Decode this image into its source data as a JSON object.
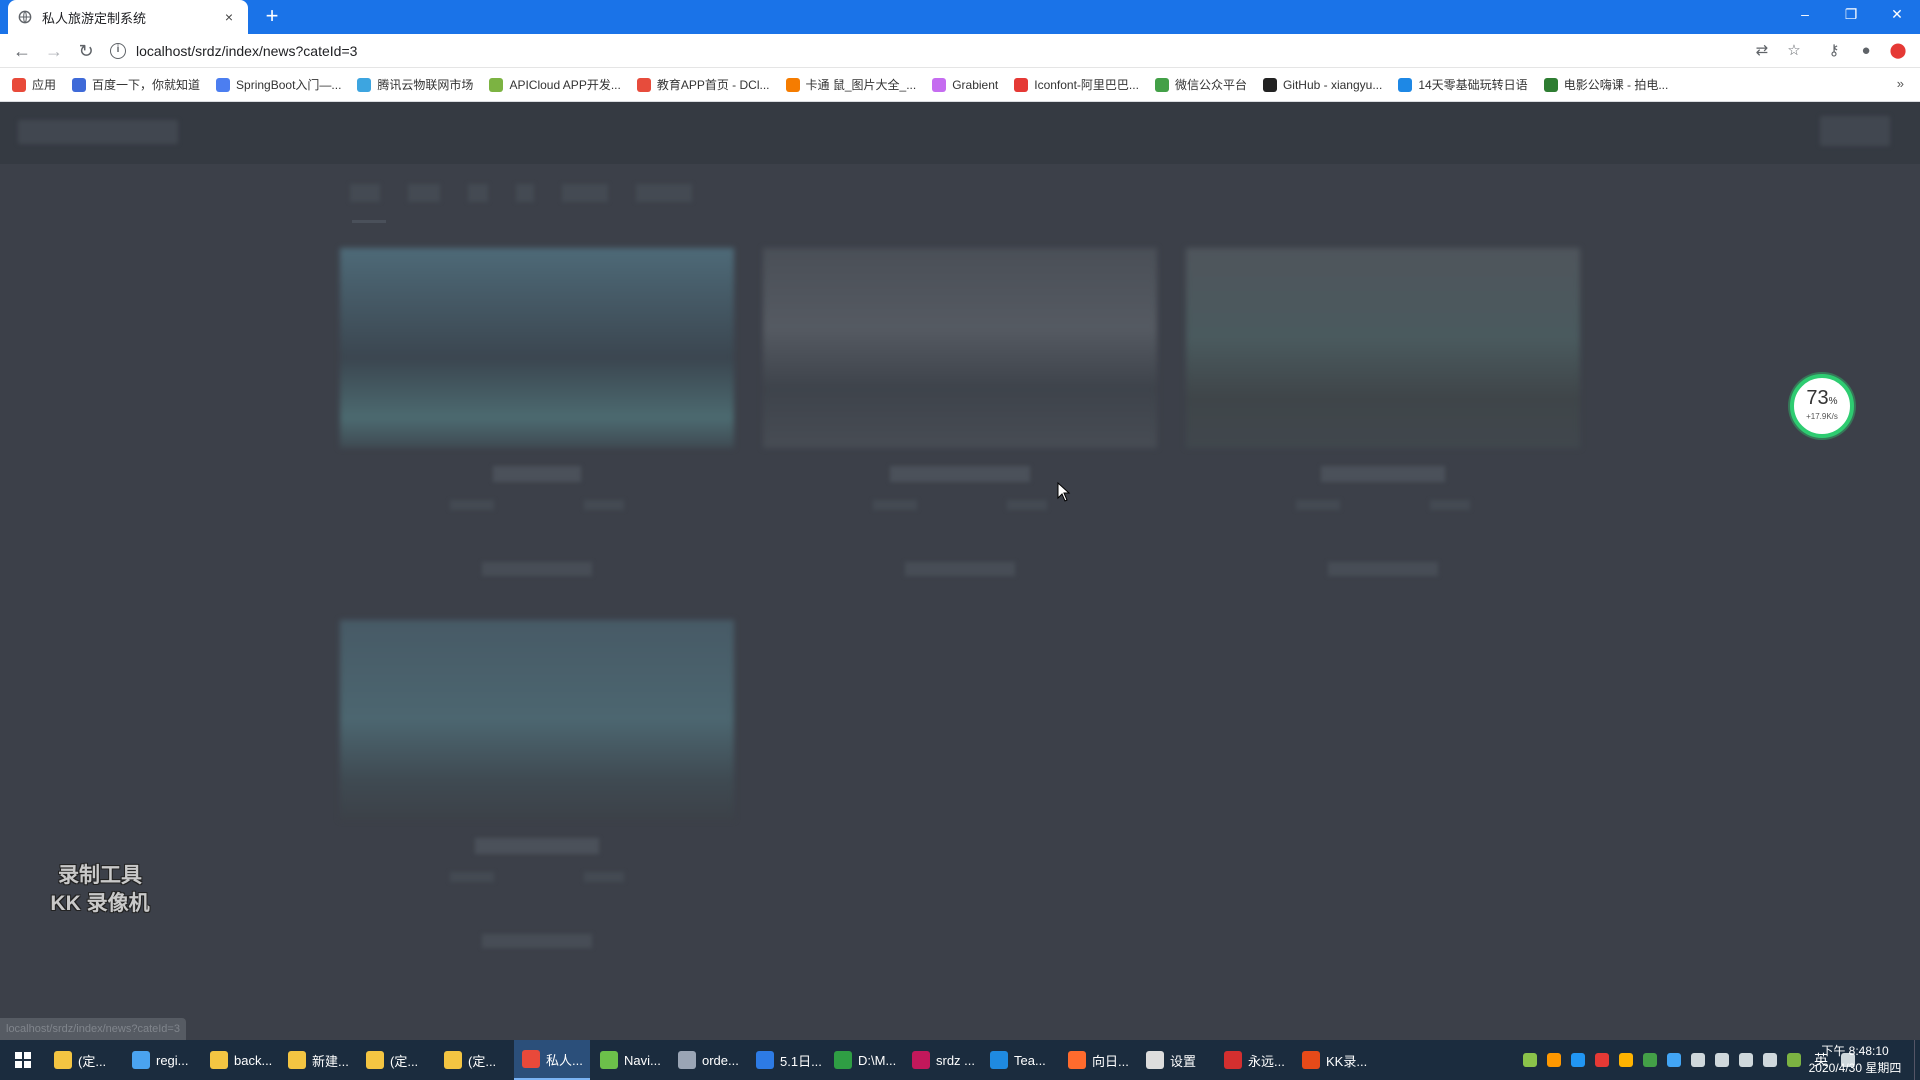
{
  "browser": {
    "tab_title": "私人旅游定制系统",
    "tab_close": "×",
    "new_tab": "+",
    "window_controls": {
      "minimize": "–",
      "restore": "❐",
      "close": "✕"
    },
    "address": "localhost/srdz/index/news?cateId=3",
    "info_glyph": "i",
    "bookmarks": [
      {
        "label": "应用",
        "color": "#e84a3a"
      },
      {
        "label": "百度一下，你就知道",
        "color": "#3f6ad8"
      },
      {
        "label": "SpringBoot入门—...",
        "color": "#4c7ef0"
      },
      {
        "label": "腾讯云物联网市场",
        "color": "#3da5e0"
      },
      {
        "label": "APICloud APP开发...",
        "color": "#7cb342"
      },
      {
        "label": "教育APP首页 - DCl...",
        "color": "#e74c3c"
      },
      {
        "label": "卡通 鼠_图片大全_...",
        "color": "#f57c00"
      },
      {
        "label": "Grabient",
        "color": "#c56cf0"
      },
      {
        "label": "Iconfont-阿里巴巴...",
        "color": "#e53935"
      },
      {
        "label": "微信公众平台",
        "color": "#43a047"
      },
      {
        "label": "GitHub - xiangyu...",
        "color": "#222222"
      },
      {
        "label": "14天零基础玩转日语",
        "color": "#1e88e5"
      },
      {
        "label": "电影公嗨课 - 拍电...",
        "color": "#2e7d32"
      }
    ],
    "bookmarks_more": "»",
    "status_url": "localhost/srdz/index/news?cateId=3"
  },
  "speed_widget": {
    "percent": "73",
    "percent_sign": "%",
    "rate": "+17.9K/s"
  },
  "watermark": {
    "line1": "录制工具",
    "line2": "KK 录像机"
  },
  "taskbar": {
    "tasks": [
      {
        "label": "(定...",
        "color": "#f4c542",
        "active": false
      },
      {
        "label": "regi...",
        "color": "#4aa3f0",
        "active": false
      },
      {
        "label": "back...",
        "color": "#f4c542",
        "active": false
      },
      {
        "label": "新建...",
        "color": "#f4c542",
        "active": false
      },
      {
        "label": "(定...",
        "color": "#f4c542",
        "active": false
      },
      {
        "label": "(定...",
        "color": "#f4c542",
        "active": false
      },
      {
        "label": "私人...",
        "color": "#e8493a",
        "active": true
      },
      {
        "label": "Navi...",
        "color": "#6cc04a",
        "active": false
      },
      {
        "label": "orde...",
        "color": "#9aa5b5",
        "active": false
      },
      {
        "label": "5.1日...",
        "color": "#2d7be5",
        "active": false
      },
      {
        "label": "D:\\M...",
        "color": "#2f9e44",
        "active": false
      },
      {
        "label": "srdz ...",
        "color": "#c2185b",
        "active": false
      },
      {
        "label": "Tea...",
        "color": "#1f8ae0",
        "active": false
      },
      {
        "label": "向日...",
        "color": "#ff6b2d",
        "active": false
      },
      {
        "label": "设置",
        "color": "#dddddd",
        "active": false
      },
      {
        "label": "永远...",
        "color": "#d32f2f",
        "active": false
      },
      {
        "label": "KK录...",
        "color": "#e64a19",
        "active": false
      }
    ],
    "lang": "英",
    "time": "下午 8:48:10",
    "date": "2020/4/30 星期四"
  }
}
